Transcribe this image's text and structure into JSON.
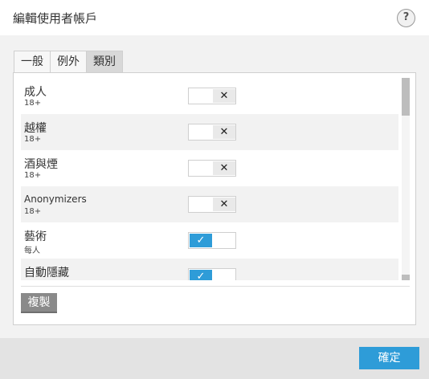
{
  "window": {
    "title": "編輯使用者帳戶",
    "help_icon": "question-icon",
    "help_label": "?"
  },
  "tabs": [
    {
      "label": "一般",
      "active": false
    },
    {
      "label": "例外",
      "active": false
    },
    {
      "label": "類別",
      "active": true
    }
  ],
  "categories": [
    {
      "name": "成人",
      "age": "18+",
      "enabled": false
    },
    {
      "name": "越權",
      "age": "18+",
      "enabled": false
    },
    {
      "name": "酒與煙",
      "age": "18+",
      "enabled": false
    },
    {
      "name": "Anonymizers",
      "age": "18+",
      "enabled": false
    },
    {
      "name": "藝術",
      "age": "每人",
      "enabled": true
    },
    {
      "name": "自動隱藏",
      "age": "",
      "enabled": true
    }
  ],
  "toggle_icons": {
    "off": "✕",
    "on": "✓"
  },
  "buttons": {
    "copy": "複製",
    "confirm": "確定"
  },
  "colors": {
    "accent": "#2e9cd8",
    "copy_button": "#8a8a8a"
  }
}
